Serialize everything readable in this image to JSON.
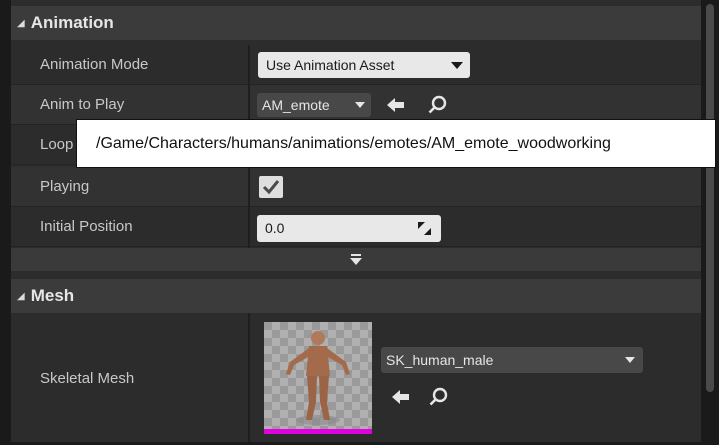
{
  "animation": {
    "header": "Animation",
    "rows": {
      "animation_mode": {
        "label": "Animation Mode",
        "value": "Use Animation Asset"
      },
      "anim_to_play": {
        "label": "Anim to Play",
        "value": "AM_emote"
      },
      "looping": {
        "label": "Loop"
      },
      "playing": {
        "label": "Playing",
        "checked": true
      },
      "initial_position": {
        "label": "Initial Position",
        "value": "0.0"
      }
    },
    "tooltip": "/Game/Characters/humans/animations/emotes/AM_emote_woodworking"
  },
  "mesh": {
    "header": "Mesh",
    "skeletal_mesh": {
      "label": "Skeletal Mesh",
      "value": "SK_human_male"
    }
  },
  "icons": [
    "triangle-down-icon",
    "arrow-left-icon",
    "search-icon",
    "checkmark-icon",
    "resize-icon",
    "chevron-down-icon"
  ],
  "colors": {
    "panel": "#2c2c2c",
    "header": "#3b3b3b",
    "thumbnail_bar": "#e000e0"
  }
}
